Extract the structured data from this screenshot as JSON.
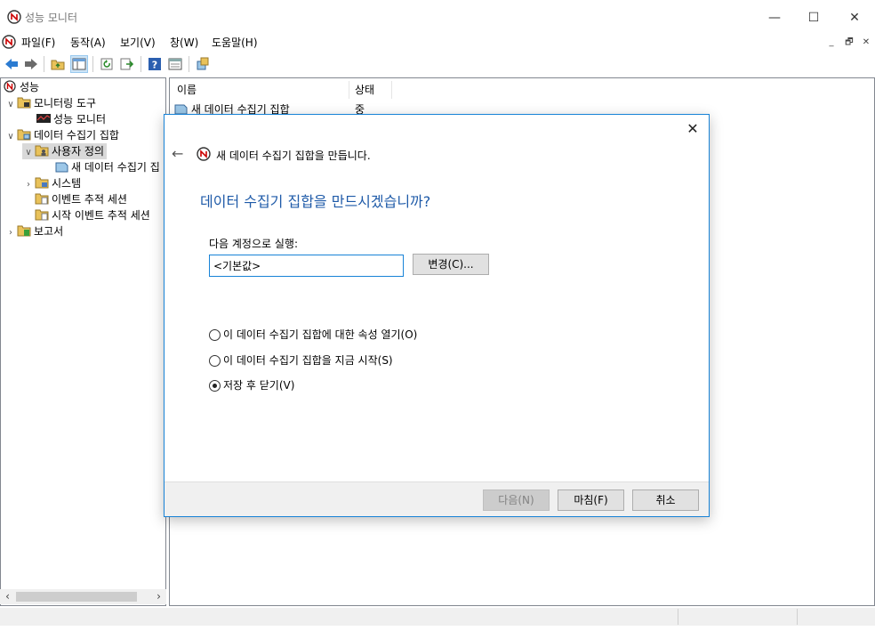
{
  "window": {
    "title": "성능 모니터"
  },
  "menu": {
    "items": [
      "파일(F)",
      "동작(A)",
      "보기(V)",
      "창(W)",
      "도움말(H)"
    ]
  },
  "mdi_buttons": [
    "_",
    "🗗",
    "✕"
  ],
  "toolbar": {
    "icons": [
      "back-icon",
      "forward-icon",
      "up-folder-icon",
      "show-hide-tree-icon",
      "refresh-icon",
      "export-icon",
      "help-icon",
      "properties-icon",
      "new-data-collector-icon"
    ]
  },
  "tree": {
    "items": [
      {
        "label": "성능",
        "level": 0,
        "expander": "",
        "icon": "perfmon-icon"
      },
      {
        "label": "모니터링 도구",
        "level": 1,
        "expander": "expanded",
        "icon": "folder-tools-icon"
      },
      {
        "label": "성능 모니터",
        "level": 2,
        "expander": "",
        "icon": "chart-monitor-icon"
      },
      {
        "label": "데이터 수집기 집합",
        "level": 1,
        "expander": "expanded",
        "icon": "folder-collector-icon"
      },
      {
        "label": "사용자 정의",
        "level": 2,
        "expander": "expanded",
        "icon": "folder-user-icon",
        "selected": true
      },
      {
        "label": "새 데이터 수집기 집",
        "level": 3,
        "expander": "",
        "icon": "collector-set-icon"
      },
      {
        "label": "시스템",
        "level": 2,
        "expander": "collapsed",
        "icon": "folder-system-icon"
      },
      {
        "label": "이벤트 추적 세션",
        "level": 2,
        "expander": "",
        "icon": "folder-trace-icon"
      },
      {
        "label": "시작 이벤트 추적 세션",
        "level": 2,
        "expander": "",
        "icon": "folder-trace-icon"
      },
      {
        "label": "보고서",
        "level": 0,
        "expander": "collapsed",
        "icon": "folder-report-icon"
      }
    ]
  },
  "list": {
    "columns": [
      "이름",
      "상태"
    ],
    "rows": [
      {
        "name": "새 데이터 수집기 집합",
        "status": "중지됨"
      }
    ]
  },
  "dialog": {
    "header": "새 데이터 수집기 집합을 만듭니다.",
    "heading": "데이터 수집기 집합을 만드시겠습니까?",
    "account_label": "다음 계정으로 실행:",
    "account_value": "<기본값>",
    "change_button": "변경(C)...",
    "options": [
      {
        "label": "이 데이터 수집기 집합에 대한 속성 열기(O)",
        "checked": false
      },
      {
        "label": "이 데이터 수집기 집합을 지금 시작(S)",
        "checked": false
      },
      {
        "label": "저장 후 닫기(V)",
        "checked": true
      }
    ],
    "buttons": {
      "next": "다음(N)",
      "finish": "마침(F)",
      "cancel": "취소"
    }
  },
  "colors": {
    "accent": "#1883d7",
    "heading": "#1e5aa8",
    "selection": "#d9d9d9"
  }
}
